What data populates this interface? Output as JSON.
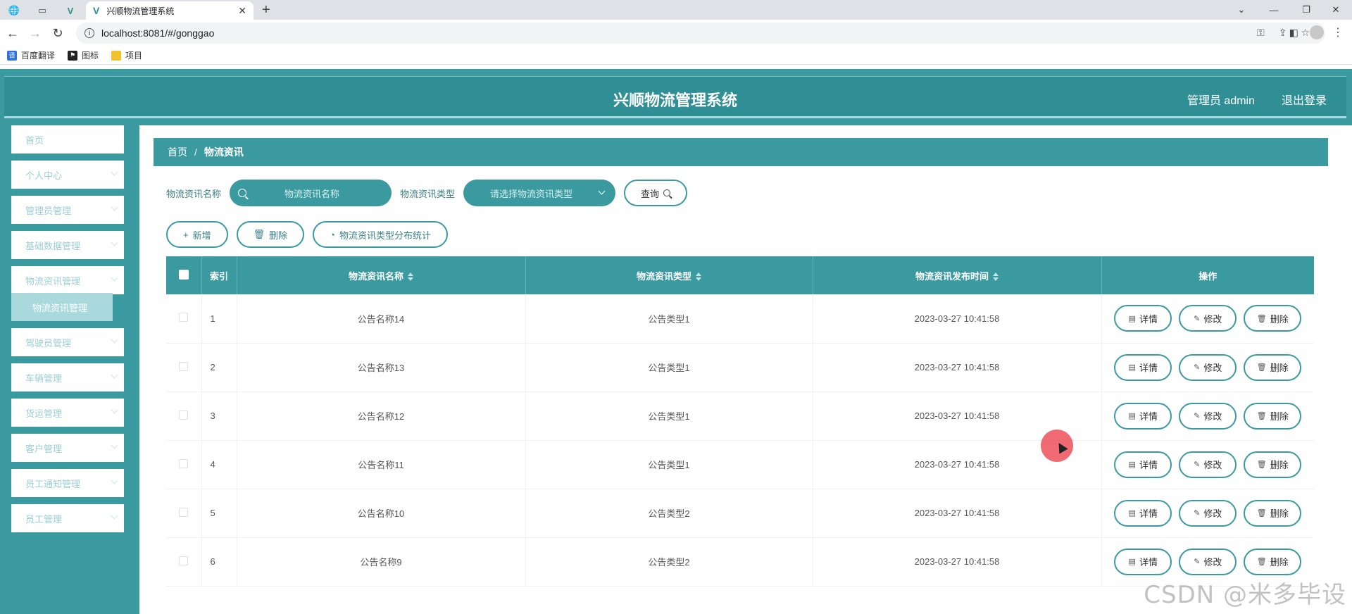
{
  "browser": {
    "tab_title": "兴顺物流管理系统",
    "url": "localhost:8081/#/gonggao",
    "bookmarks": [
      {
        "label": "百度翻译",
        "icon": "translate-icon",
        "color": "#2f6fe0"
      },
      {
        "label": "图标",
        "icon": "flag-icon",
        "color": "#222222"
      },
      {
        "label": "项目",
        "icon": "folder-icon",
        "color": "#f2c12e"
      }
    ]
  },
  "header": {
    "title": "兴顺物流管理系统",
    "user": "管理员 admin",
    "logout": "退出登录"
  },
  "sidebar": {
    "items": [
      {
        "label": "首页",
        "has_children": false
      },
      {
        "label": "个人中心",
        "has_children": true
      },
      {
        "label": "管理员管理",
        "has_children": true
      },
      {
        "label": "基础数据管理",
        "has_children": true
      },
      {
        "label": "物流资讯管理",
        "has_children": true
      },
      {
        "label": "驾驶员管理",
        "has_children": true
      },
      {
        "label": "车辆管理",
        "has_children": true
      },
      {
        "label": "货运管理",
        "has_children": true
      },
      {
        "label": "客户管理",
        "has_children": true
      },
      {
        "label": "员工通知管理",
        "has_children": true
      },
      {
        "label": "员工管理",
        "has_children": true
      }
    ],
    "active_sub": "物流资讯管理"
  },
  "breadcrumb": {
    "home": "首页",
    "separator": "/",
    "current": "物流资讯"
  },
  "search": {
    "name_label": "物流资讯名称",
    "name_placeholder": "物流资讯名称",
    "type_label": "物流资讯类型",
    "type_placeholder": "请选择物流资讯类型",
    "query_button": "查询"
  },
  "actions": {
    "add": "新增",
    "delete": "删除",
    "stats": "物流资讯类型分布统计"
  },
  "table": {
    "columns": [
      "索引",
      "物流资讯名称",
      "物流资讯类型",
      "物流资讯发布时间",
      "操作"
    ],
    "row_actions": {
      "detail": "详情",
      "edit": "修改",
      "delete": "删除"
    },
    "rows": [
      {
        "index": "1",
        "name": "公告名称14",
        "type": "公告类型1",
        "time": "2023-03-27 10:41:58"
      },
      {
        "index": "2",
        "name": "公告名称13",
        "type": "公告类型1",
        "time": "2023-03-27 10:41:58"
      },
      {
        "index": "3",
        "name": "公告名称12",
        "type": "公告类型1",
        "time": "2023-03-27 10:41:58"
      },
      {
        "index": "4",
        "name": "公告名称11",
        "type": "公告类型1",
        "time": "2023-03-27 10:41:58"
      },
      {
        "index": "5",
        "name": "公告名称10",
        "type": "公告类型2",
        "time": "2023-03-27 10:41:58"
      },
      {
        "index": "6",
        "name": "公告名称9",
        "type": "公告类型2",
        "time": "2023-03-27 10:41:58"
      }
    ]
  },
  "watermark": "CSDN @米多毕设",
  "colors": {
    "primary": "#3a9aa0",
    "header": "#2f8f94",
    "submenu": "#a9d9dc"
  }
}
